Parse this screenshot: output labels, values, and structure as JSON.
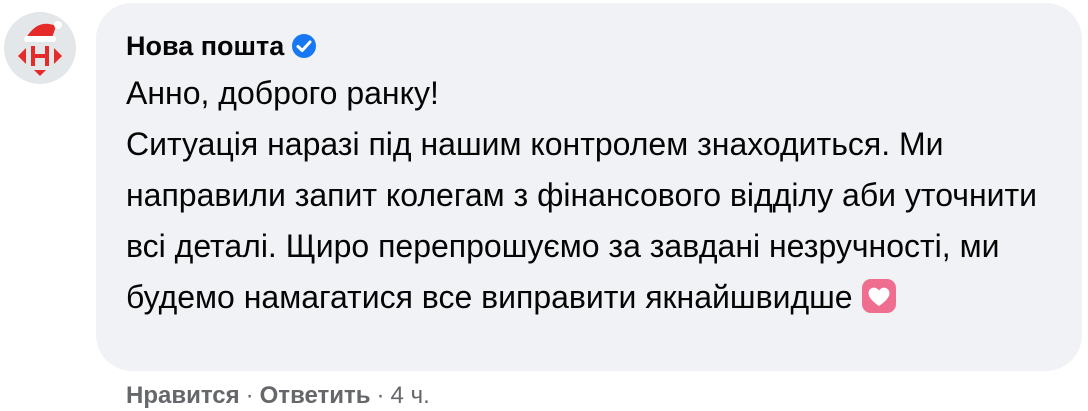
{
  "comment": {
    "author": "Нова пошта",
    "verified": true,
    "avatar_icon": "nova-poshta-logo",
    "text": "Анно, доброго ранку!\nСитуація наразі під нашим контролем знаходиться. Ми направили запит колегам з фінансового відділу аби уточнити всі деталі. Щиро перепрошуємо за завдані незручності, ми будемо намагатися все виправити якнайшвидше",
    "emoji": "heart-icon",
    "bubble_color": "#f0f2f5",
    "accent_color": "#e52a2a",
    "verified_color": "#1877f2"
  },
  "actions": {
    "like_label": "Нравится",
    "separator": "·",
    "reply_label": "Ответить",
    "time": "4 ч."
  }
}
